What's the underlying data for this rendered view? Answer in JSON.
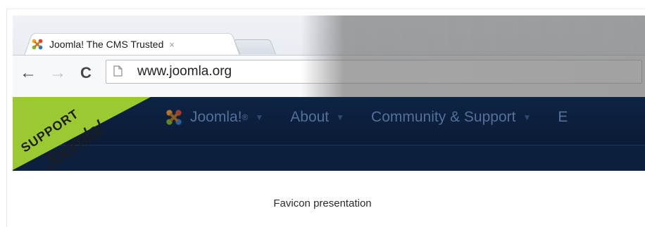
{
  "browser": {
    "tab_title": "Joomla! The CMS Trusted",
    "tab_close": "×",
    "url": "www.joomla.org",
    "nav_back": "←",
    "nav_forward": "→",
    "nav_reload": "C"
  },
  "site": {
    "banner_top": "SUPPORT",
    "banner_logo": "Joomla!",
    "brand": "Joomla!",
    "brand_mark": "®",
    "menu": [
      "About",
      "Community & Support",
      "E"
    ]
  },
  "caption": "Favicon presentation",
  "colors": {
    "nav_bg": "#0b1c38",
    "nav_text": "#54709a",
    "banner": "#9ac931"
  }
}
